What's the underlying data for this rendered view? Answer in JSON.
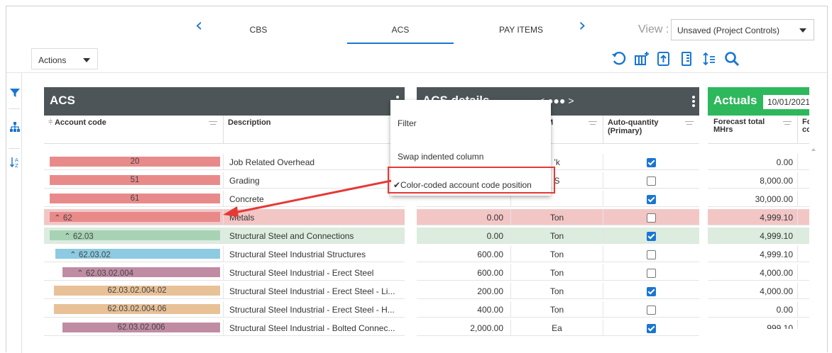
{
  "nav": {
    "tabs": [
      {
        "label": "CBS"
      },
      {
        "label": "ACS",
        "active": true
      },
      {
        "label": "PAY ITEMS"
      }
    ],
    "view_label": "View :",
    "view_value": "Unsaved (Project Controls)"
  },
  "toolbar": {
    "actions_label": "Actions",
    "icons": [
      "undo-icon",
      "add-column-icon",
      "export-icon",
      "column-settings-icon",
      "row-height-icon",
      "search-icon"
    ]
  },
  "rail": {
    "icons": [
      "filter-icon",
      "hierarchy-icon",
      "sort-az-icon"
    ]
  },
  "acs_panel": {
    "title": "ACS",
    "col_account_code": "Account code",
    "col_description": "Description",
    "rows": [
      {
        "code": "20",
        "description": "Job Related Overhead",
        "color": "#e98a8a",
        "indent": 0,
        "expander": false
      },
      {
        "code": "51",
        "description": "Grading",
        "color": "#e98a8a",
        "indent": 0,
        "expander": false
      },
      {
        "code": "61",
        "description": "Concrete",
        "color": "#e98a8a",
        "indent": 0,
        "expander": false
      },
      {
        "code": "62",
        "description": "Metals",
        "color": "#e98a8a",
        "indent": 0,
        "expander": true,
        "row_bg": "#f3c6c6"
      },
      {
        "code": "62.03",
        "description": "Structural Steel and Connections",
        "color": "#a7d3b4",
        "indent": 1,
        "expander": true,
        "row_bg": "#dcecdf"
      },
      {
        "code": "62.03.02",
        "description": "Structural Steel Industrial Structures",
        "color": "#8ccbe2",
        "indent": 2,
        "expander": true
      },
      {
        "code": "62.03.02.004",
        "description": "Structural Steel Industrial - Erect Steel",
        "color": "#c08ca4",
        "indent": 3,
        "expander": true
      },
      {
        "code": "62.03.02.004.02",
        "description": "Structural Steel Industrial - Erect Steel - Li...",
        "color": "#e8c197",
        "indent": 4,
        "expander": false
      },
      {
        "code": "62.03.02.004.06",
        "description": "Structural Steel Industrial - Erect Steel - H...",
        "color": "#e8c197",
        "indent": 4,
        "expander": false
      },
      {
        "code": "62.03.02.006",
        "description": "Structural Steel Industrial - Bolted Connec...",
        "color": "#c08ca4",
        "indent": 3,
        "expander": false
      }
    ]
  },
  "details_panel": {
    "title": "ACS details",
    "pager": "< ●●● >",
    "col_uom": "M",
    "col_autoqty": "Auto-quantity (Primary)",
    "rows": [
      {
        "qty": "",
        "uom": "’k",
        "auto": true
      },
      {
        "qty": "",
        "uom": "S",
        "auto": false
      },
      {
        "qty": "",
        "uom": "",
        "auto": true
      },
      {
        "qty": "0.00",
        "uom": "Ton",
        "auto": false
      },
      {
        "qty": "0.00",
        "uom": "Ton",
        "auto": true
      },
      {
        "qty": "600.00",
        "uom": "Ton",
        "auto": false
      },
      {
        "qty": "600.00",
        "uom": "Ton",
        "auto": false
      },
      {
        "qty": "200.00",
        "uom": "Ton",
        "auto": true
      },
      {
        "qty": "400.00",
        "uom": "Ton",
        "auto": false
      },
      {
        "qty": "2,000.00",
        "uom": "Ea",
        "auto": true
      }
    ]
  },
  "actuals_panel": {
    "title": "Actuals",
    "date": "10/01/2021",
    "col_forecast": "Forecast total MHrs",
    "col_next": "Fo co",
    "rows": [
      "0.00",
      "8,000.00",
      "30,000.00",
      "4,999.10",
      "4,999.10",
      "4,999.10",
      "4,000.00",
      "4,000.00",
      "0.00",
      "999.10"
    ]
  },
  "context_menu": {
    "items": [
      "Filter",
      "Swap indented column",
      "✔Color-coded account code position"
    ]
  },
  "colors": {
    "accent": "#1976d2",
    "header_bg": "#4d5558",
    "actuals_green": "#2eb85c",
    "highlight_red": "#e53935"
  }
}
